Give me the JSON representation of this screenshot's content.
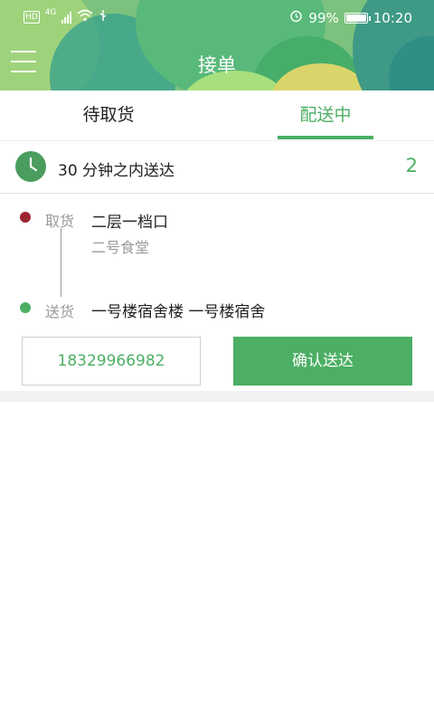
{
  "status_bar": {
    "badge": "HD",
    "network": "4G",
    "battery": "99%",
    "battery_level": 0.99,
    "time": "10:20"
  },
  "header": {
    "title": "接单"
  },
  "tabs": [
    {
      "label": "待取货",
      "active": false
    },
    {
      "label": "配送中",
      "active": true
    }
  ],
  "order": {
    "time_limit": "30 分钟之内送达",
    "count": "2",
    "pickup": {
      "label": "取货",
      "address": "二层一档口",
      "place": "二号食堂"
    },
    "delivery": {
      "label": "送货",
      "address": "一号楼宿舍楼 一号楼宿舍"
    },
    "phone": "18329966982",
    "confirm_label": "确认送达"
  },
  "colors": {
    "accent": "#4caf64",
    "pickup_dot": "#9b2530",
    "clock": "#4a9d5f"
  }
}
